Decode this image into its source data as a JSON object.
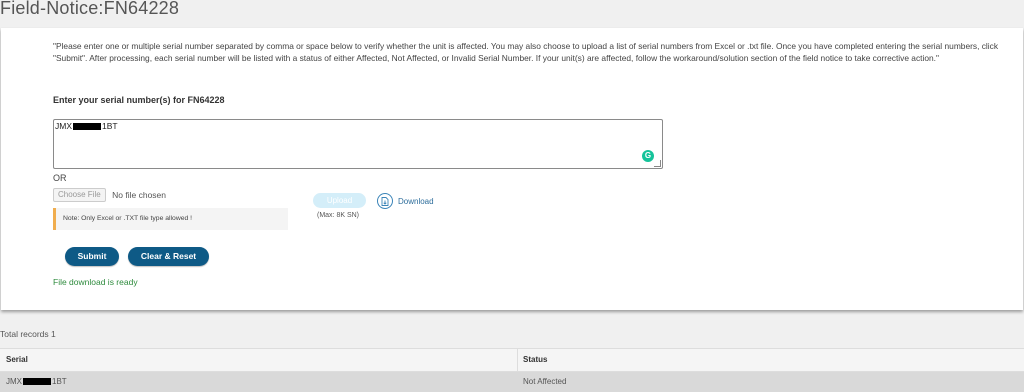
{
  "page": {
    "title": "Field-Notice:FN64228"
  },
  "form": {
    "instructions": "\"Please enter one or multiple serial number separated by comma or space below to verify whether the unit is affected. You may also choose to upload a list of serial numbers from Excel or .txt file. Once you have completed entering the serial numbers, click \"Submit\". After processing, each serial number will be listed with a status of either Affected, Not Affected, or Invalid Serial Number. If your unit(s) are affected, follow the workaround/solution section of the field notice to take corrective action.\"",
    "serial_heading": "Enter your serial number(s) for FN64228",
    "serial_value_prefix": "JMX",
    "serial_value_suffix": "1BT",
    "or_label": "OR",
    "choose_file_label": "Choose File",
    "no_file_label": "No file chosen",
    "note": "Note: Only Excel or .TXT file type allowed !",
    "upload_label": "Upload",
    "upload_max": "(Max: 8K SN)",
    "download_label": "Download",
    "submit_label": "Submit",
    "clear_label": "Clear & Reset",
    "download_ready": "File download is ready"
  },
  "results": {
    "total_records": "Total records 1",
    "columns": [
      "Serial",
      "Status"
    ],
    "rows": [
      {
        "serial_prefix": "JMX",
        "serial_suffix": "1BT",
        "status": "Not Affected"
      }
    ]
  },
  "icons": {
    "grammarly": "grammarly-icon",
    "download": "document-download-icon"
  },
  "colors": {
    "primary_button": "#0e5a86",
    "success_text": "#2e8b3d",
    "note_border": "#f0ad4e",
    "upload_disabled": "#d4eef9"
  }
}
